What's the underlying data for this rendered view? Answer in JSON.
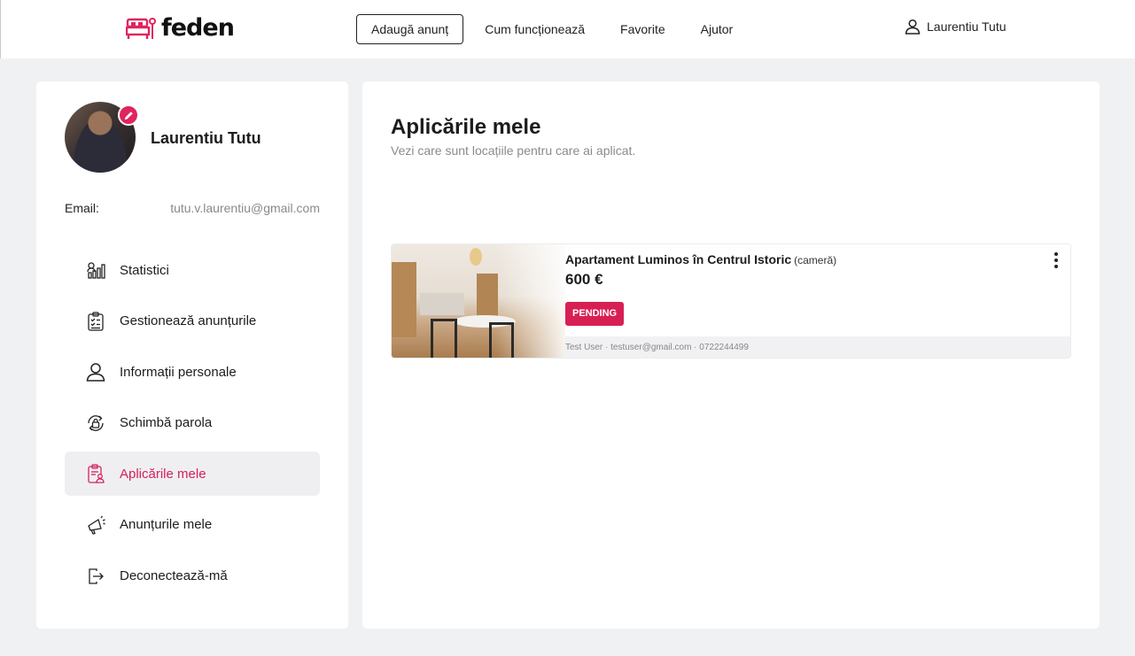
{
  "app": {
    "logo_text": "feden",
    "brand_color": "#e0245e"
  },
  "header": {
    "add_listing": "Adaugă anunț",
    "nav": [
      "Cum funcționează",
      "Favorite",
      "Ajutor"
    ],
    "user_name": "Laurentiu Tutu"
  },
  "profile": {
    "name": "Laurentiu Tutu",
    "email_label": "Email:",
    "email_value": "tutu.v.laurentiu@gmail.com"
  },
  "menu": [
    {
      "label": "Statistici",
      "icon": "statistics-icon"
    },
    {
      "label": "Gestionează anunțurile",
      "icon": "clipboard-list-icon"
    },
    {
      "label": "Informații personale",
      "icon": "user-icon"
    },
    {
      "label": "Schimbă parola",
      "icon": "lock-refresh-icon"
    },
    {
      "label": "Aplicările mele",
      "icon": "clipboard-user-icon",
      "active": true
    },
    {
      "label": "Anunțurile mele",
      "icon": "megaphone-icon"
    },
    {
      "label": "Deconectează-mă",
      "icon": "logout-icon"
    }
  ],
  "main": {
    "title": "Aplicările mele",
    "subtitle": "Vezi care sunt locațiile pentru care ai aplicat.",
    "applications": [
      {
        "title": "Apartament Luminos în Centrul Istoric",
        "type": "(cameră)",
        "price": "600 €",
        "status": "PENDING",
        "status_color": "#d81f54",
        "contact": "Test User · testuser@gmail.com · 0722244499"
      }
    ]
  }
}
